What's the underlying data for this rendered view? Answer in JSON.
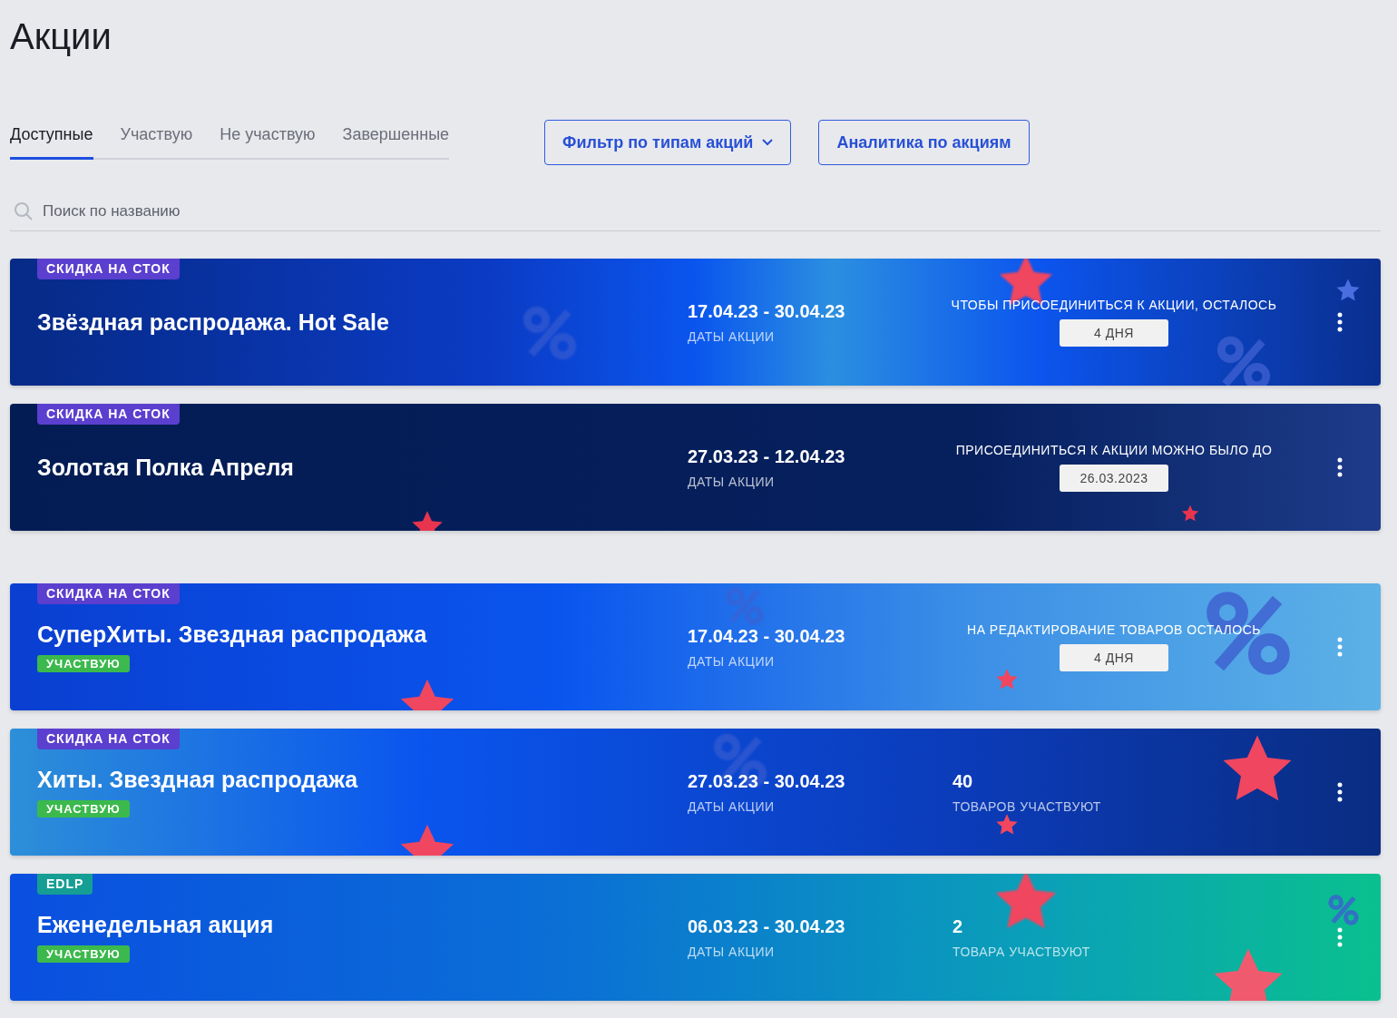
{
  "page_title": "Акции",
  "tabs": [
    {
      "label": "Доступные",
      "selected": true
    },
    {
      "label": "Участвую",
      "selected": false
    },
    {
      "label": "Не участвую",
      "selected": false
    },
    {
      "label": "Завершенные",
      "selected": false
    }
  ],
  "filter_button": {
    "label": "Фильтр по типам акций"
  },
  "analytics_button": {
    "label": "Аналитика по акциям"
  },
  "search": {
    "placeholder": "Поиск по названию"
  },
  "sections": [
    {
      "promotions": [
        {
          "tag": "СКИДКА НА СТОК",
          "color": "#5b3fcf",
          "title": "Звёздная распродажа. Hot Sale",
          "participating": false,
          "dates": "17.04.23 - 30.04.23",
          "dates_caption": "ДАТЫ АКЦИИ",
          "info": {
            "kind": "deadline",
            "caption": "ЧТОБЫ ПРИСОЕДИНИТЬСЯ К АКЦИИ, ОСТАЛОСЬ",
            "value": "4 ДНЯ"
          }
        },
        {
          "tag": "СКИДКА НА СТОК",
          "color": "#5b3fcf",
          "title": "Золотая Полка Апреля",
          "participating": false,
          "dates": "27.03.23 - 12.04.23",
          "dates_caption": "ДАТЫ АКЦИИ",
          "info": {
            "kind": "deadline",
            "caption": "ПРИСОЕДИНИТЬСЯ К АКЦИИ МОЖНО БЫЛО ДО",
            "value": "26.03.2023"
          }
        }
      ]
    },
    {
      "promotions": [
        {
          "tag": "СКИДКА НА СТОК",
          "color": "#5b3fcf",
          "title": "СуперХиты. Звездная распродажа",
          "participating": true,
          "participating_label": "УЧАСТВУЮ",
          "dates": "17.04.23 - 30.04.23",
          "dates_caption": "ДАТЫ АКЦИИ",
          "info": {
            "kind": "deadline",
            "caption": "НА РЕДАКТИРОВАНИЕ ТОВАРОВ ОСТАЛОСЬ",
            "value": "4 ДНЯ"
          }
        },
        {
          "tag": "СКИДКА НА СТОК",
          "color": "#5b3fcf",
          "title": "Хиты. Звездная распродажа",
          "participating": true,
          "participating_label": "УЧАСТВУЮ",
          "dates": "27.03.23 - 30.04.23",
          "dates_caption": "ДАТЫ АКЦИИ",
          "info": {
            "kind": "count",
            "value": "40",
            "caption": "ТОВАРОВ УЧАСТВУЮТ"
          }
        },
        {
          "tag": "EDLP",
          "color": "#159e93",
          "title": "Еженедельная акция",
          "participating": true,
          "participating_label": "УЧАСТВУЮ",
          "dates": "06.03.23 - 30.04.23",
          "dates_caption": "ДАТЫ АКЦИИ",
          "info": {
            "kind": "count",
            "value": "2",
            "caption": "ТОВАРА УЧАСТВУЮТ"
          }
        }
      ]
    }
  ]
}
